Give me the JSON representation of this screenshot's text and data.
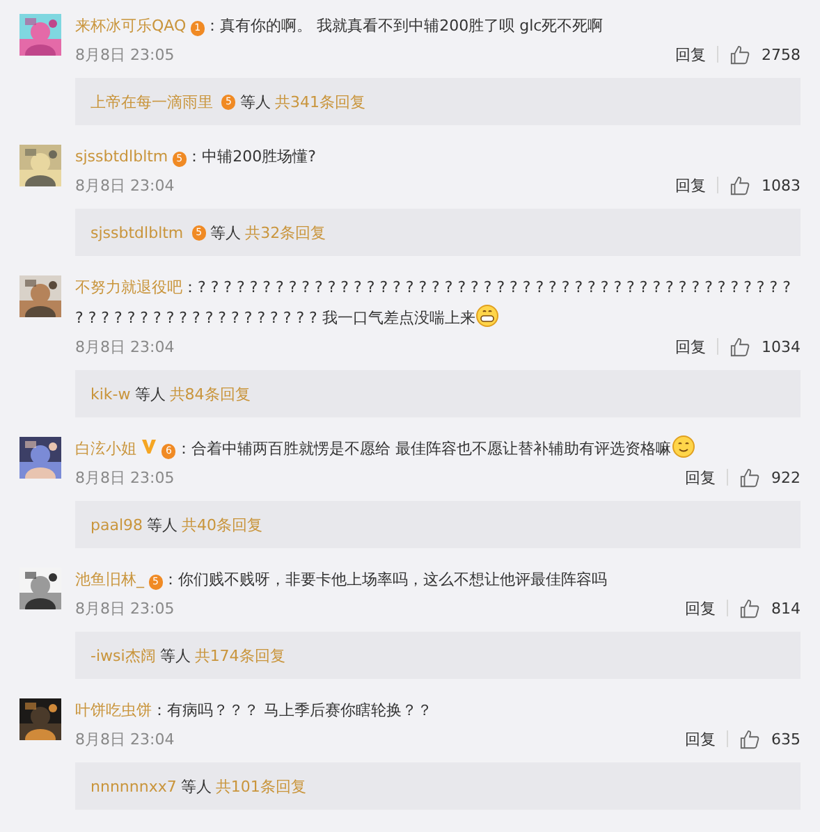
{
  "comments": [
    {
      "name": "来杯冰可乐QAQ",
      "verified": false,
      "badge": "1",
      "text": "：真有你的啊。 我就真看不到中辅200胜了呗 glc死不死啊",
      "time": "8月8日 23:05",
      "reply_label": "回复",
      "likes": "2758",
      "replies": {
        "name": "上帝在每一滴雨里",
        "badge": "5",
        "others": "等人",
        "count": "共341条回复"
      }
    },
    {
      "name": "sjssbtdlbltm",
      "verified": false,
      "badge": "5",
      "text": "：中辅200胜场懂?",
      "time": "8月8日 23:04",
      "reply_label": "回复",
      "likes": "1083",
      "replies": {
        "name": "sjssbtdlbltm",
        "badge": "5",
        "others": "等人",
        "count": "共32条回复"
      }
    },
    {
      "name": "不努力就退役吧",
      "verified": false,
      "text": "：? ? ? ? ? ? ? ? ? ? ? ? ? ? ? ? ? ? ? ? ? ? ? ? ? ? ? ? ? ? ? ? ? ? ? ? ? ? ? ? ? ? ? ? ? ? ? ? ? ? ? ? ? ? ? ? ? ? ? ? ? ? ? ? ? 我一口气差点没喘上来",
      "emoji": {
        "kind": "grin"
      },
      "time": "8月8日 23:04",
      "reply_label": "回复",
      "likes": "1034",
      "replies": {
        "name": "kik-w",
        "others": "等人",
        "count": "共84条回复"
      }
    },
    {
      "name": "白泫小姐",
      "verified": true,
      "badge": "6",
      "text": "：合着中辅两百胜就愣是不愿给 最佳阵容也不愿让替补辅助有评选资格嘛",
      "emoji": {
        "kind": "smile"
      },
      "time": "8月8日 23:05",
      "reply_label": "回复",
      "likes": "922",
      "replies": {
        "name": "paal98",
        "others": "等人",
        "count": "共40条回复"
      }
    },
    {
      "name": "池鱼旧林_",
      "verified": false,
      "badge": "5",
      "text": "：你们贱不贱呀，非要卡他上场率吗，这么不想让他评最佳阵容吗",
      "time": "8月8日 23:05",
      "reply_label": "回复",
      "likes": "814",
      "replies": {
        "name": "-iwsi杰阔",
        "others": "等人",
        "count": "共174条回复"
      }
    },
    {
      "name": "叶饼吃虫饼",
      "verified": false,
      "text": "：有病吗？？？ 马上季后赛你瞎轮换？？",
      "time": "8月8日 23:04",
      "reply_label": "回复",
      "likes": "635",
      "replies": {
        "name": "nnnnnnxx7",
        "others": "等人",
        "count": "共101条回复"
      }
    }
  ]
}
